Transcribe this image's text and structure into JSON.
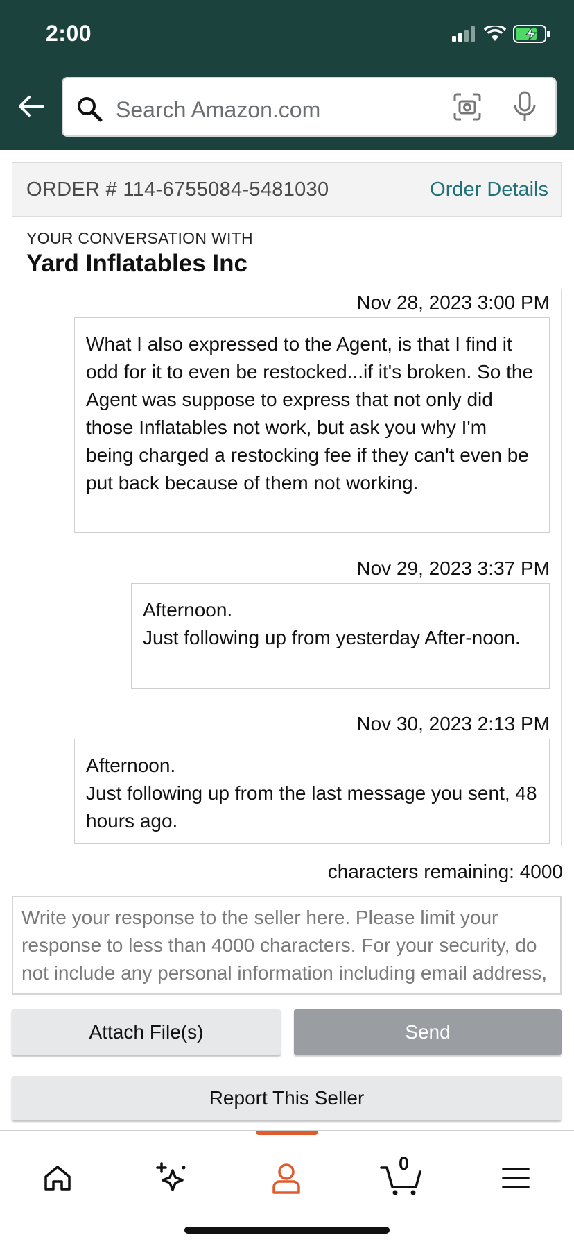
{
  "status_bar": {
    "time": "2:00"
  },
  "search": {
    "placeholder": "Search Amazon.com"
  },
  "order": {
    "number": "ORDER # 114-6755084-5481030",
    "details_link": "Order Details"
  },
  "conversation": {
    "label": "YOUR CONVERSATION WITH",
    "seller": "Yard Inflatables Inc",
    "messages": [
      {
        "timestamp": "Nov 28, 2023 3:00 PM",
        "text": "What I also expressed to the Agent, is that I find it odd for it to even be restocked...if it's broken. So the Agent was suppose to express that not only did those Inflatables not work, but ask you why I'm being charged a restocking fee if they can't even be put back because of them not working."
      },
      {
        "timestamp": "Nov 29, 2023 3:37 PM",
        "line1": "Afternoon.",
        "line2": "Just following up from yesterday After-noon."
      },
      {
        "timestamp": "Nov 30, 2023 2:13 PM",
        "line1": "Afternoon.",
        "line2": "Just following up from the last message you sent, 48 hours ago."
      }
    ]
  },
  "compose": {
    "chars_remaining": "characters remaining: 4000",
    "placeholder": "Write your response to the seller here. Please limit your response to less than 4000 characters. For your security, do not include any personal information including email address, web sites' addresses or phone numbers, credit card info, or social security numbers."
  },
  "buttons": {
    "attach": "Attach File(s)",
    "send": "Send",
    "report": "Report This Seller"
  },
  "nav": {
    "items": [
      "home-icon",
      "ai-sparkle-icon",
      "account-icon",
      "cart-icon",
      "menu-icon"
    ],
    "cart_count": "0",
    "active_color": "#e05a2b"
  },
  "colors": {
    "header_bg": "#1b423d",
    "link": "#227178",
    "battery": "#4cd964"
  }
}
